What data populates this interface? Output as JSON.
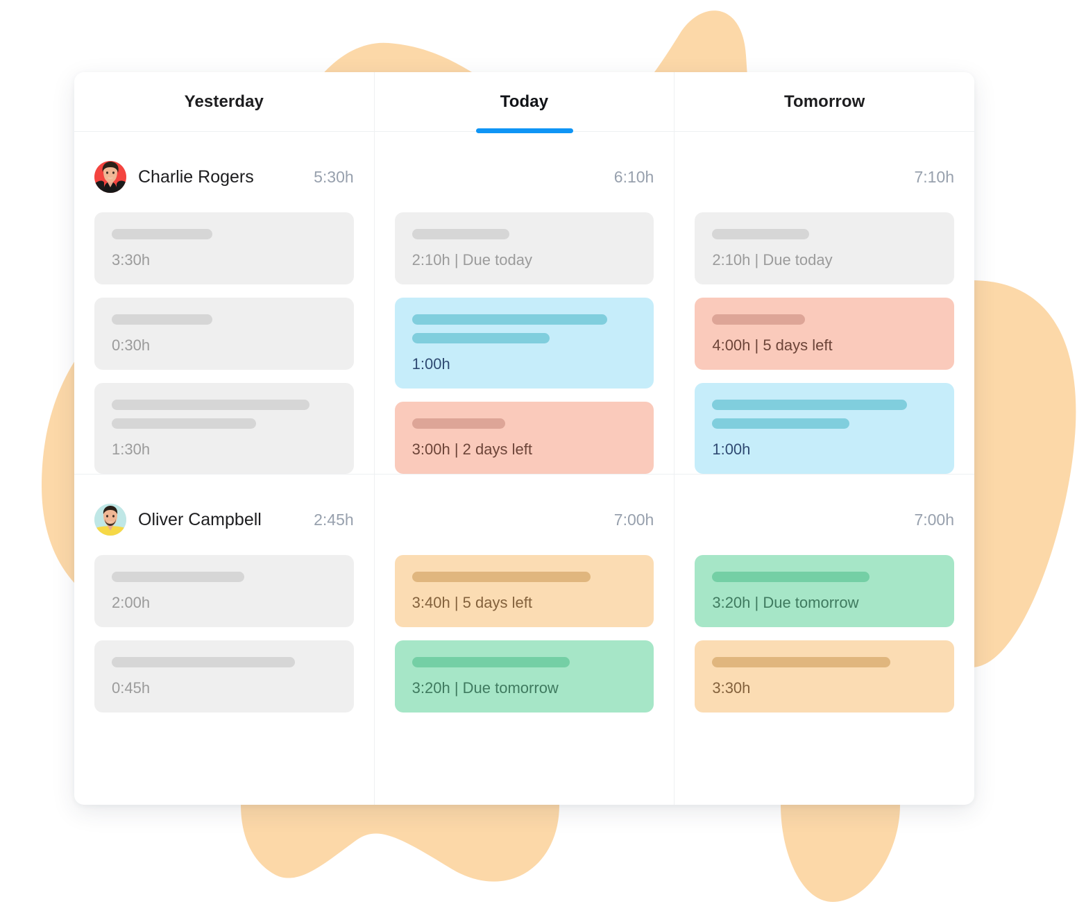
{
  "theme": {
    "accent": "#0f95f5",
    "page_bg": "#ffffff",
    "blob_color": "#fcd8a8",
    "panel_bg": "#ffffff",
    "divider": "#eef0f2"
  },
  "tabs": [
    {
      "label": "Yesterday",
      "active": false
    },
    {
      "label": "Today",
      "active": true
    },
    {
      "label": "Tomorrow",
      "active": false
    }
  ],
  "rows": [
    {
      "person": {
        "name": "Charlie Rogers",
        "avatar": "charlie-avatar"
      },
      "cells": [
        {
          "day": "Yesterday",
          "total": "5:30h",
          "tasks": [
            {
              "color": "grey",
              "bars": [
                145
              ],
              "meta": "3:30h"
            },
            {
              "color": "grey",
              "bars": [
                145
              ],
              "meta": "0:30h"
            },
            {
              "color": "grey",
              "bars": [
                285,
                208
              ],
              "meta": "1:30h"
            }
          ]
        },
        {
          "day": "Today",
          "total": "6:10h",
          "tasks": [
            {
              "color": "grey",
              "bars": [
                140
              ],
              "meta": "2:10h | Due today"
            },
            {
              "color": "blue",
              "bars": [
                281,
                198
              ],
              "meta": "1:00h"
            },
            {
              "color": "red",
              "bars": [
                134
              ],
              "meta": "3:00h | 2 days left"
            }
          ]
        },
        {
          "day": "Tomorrow",
          "total": "7:10h",
          "tasks": [
            {
              "color": "grey",
              "bars": [
                140
              ],
              "meta": "2:10h | Due today"
            },
            {
              "color": "red",
              "bars": [
                134
              ],
              "meta": "4:00h | 5 days left"
            },
            {
              "color": "blue",
              "bars": [
                281,
                198
              ],
              "meta": "1:00h"
            }
          ]
        }
      ]
    },
    {
      "person": {
        "name": "Oliver Campbell",
        "avatar": "oliver-avatar"
      },
      "cells": [
        {
          "day": "Yesterday",
          "total": "2:45h",
          "tasks": [
            {
              "color": "grey",
              "bars": [
                191
              ],
              "meta": "2:00h"
            },
            {
              "color": "grey",
              "bars": [
                264
              ],
              "meta": "0:45h"
            }
          ]
        },
        {
          "day": "Today",
          "total": "7:00h",
          "tasks": [
            {
              "color": "orange",
              "bars": [
                257
              ],
              "meta": "3:40h | 5 days left"
            },
            {
              "color": "green",
              "bars": [
                227
              ],
              "meta": "3:20h | Due tomorrow"
            }
          ]
        },
        {
          "day": "Tomorrow",
          "total": "7:00h",
          "tasks": [
            {
              "color": "green",
              "bars": [
                227
              ],
              "meta": "3:20h | Due tomorrow"
            },
            {
              "color": "orange",
              "bars": [
                257
              ],
              "meta": "3:30h"
            }
          ]
        }
      ]
    }
  ]
}
